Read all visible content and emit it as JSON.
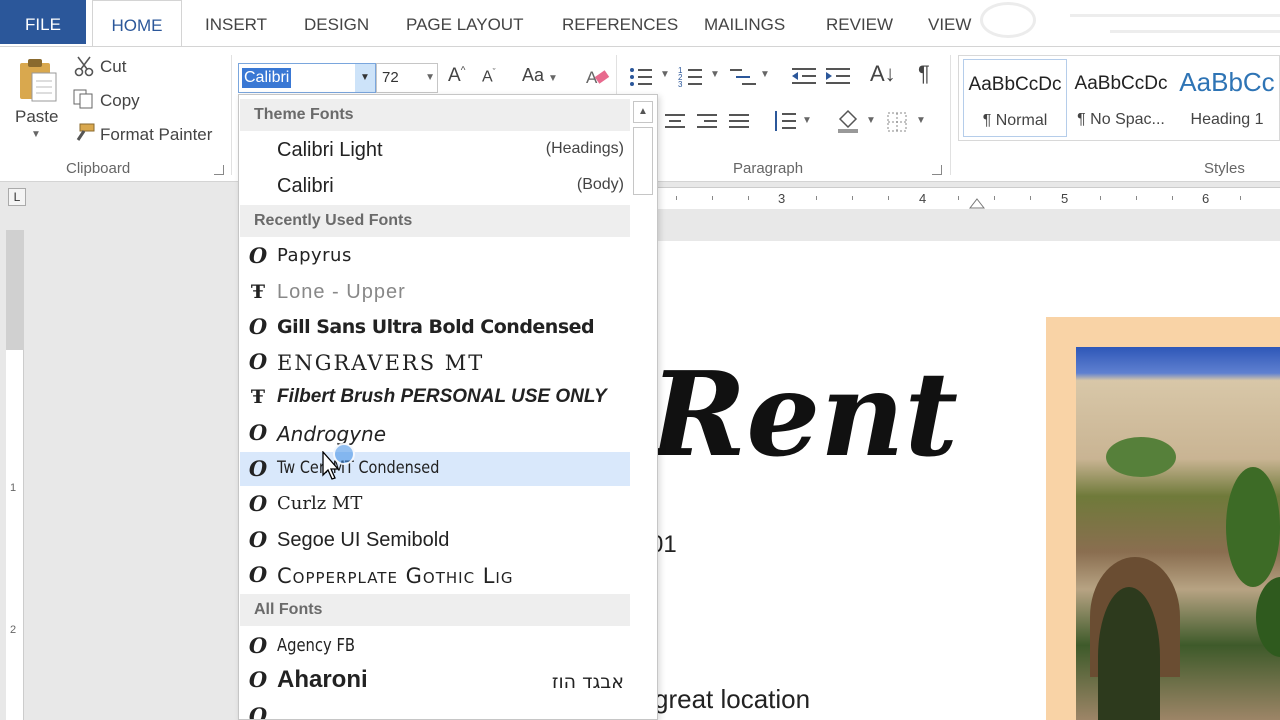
{
  "tabs": [
    "FILE",
    "HOME",
    "INSERT",
    "DESIGN",
    "PAGE LAYOUT",
    "REFERENCES",
    "MAILINGS",
    "REVIEW",
    "VIEW"
  ],
  "clipboard": {
    "paste": "Paste",
    "cut": "Cut",
    "copy": "Copy",
    "format_painter": "Format Painter",
    "group_label": "Clipboard"
  },
  "font": {
    "name": "Calibri",
    "size": "72",
    "change_case_label": "Aa"
  },
  "paragraph": {
    "group_label": "Paragraph"
  },
  "styles": {
    "group_label": "Styles",
    "items": [
      {
        "sample": "AaBbCcDc",
        "name": "¶ Normal"
      },
      {
        "sample": "AaBbCcDc",
        "name": "¶ No Spac..."
      },
      {
        "sample": "AaBbCc",
        "name": "Heading 1"
      }
    ]
  },
  "ruler": {
    "numbers": [
      "3",
      "4",
      "5",
      "6"
    ],
    "vertical_numbers": [
      "1",
      "2"
    ]
  },
  "font_dropdown": {
    "theme_header": "Theme Fonts",
    "theme_fonts": [
      {
        "name": "Calibri Light",
        "tag": "(Headings)"
      },
      {
        "name": "Calibri",
        "tag": "(Body)"
      }
    ],
    "recent_header": "Recently Used Fonts",
    "recent_fonts": [
      {
        "name": "Papyrus",
        "icon": "opentype-icon"
      },
      {
        "name": "Lone - Upper",
        "icon": "truetype-icon"
      },
      {
        "name": "Gill Sans Ultra Bold Condensed",
        "icon": "opentype-icon"
      },
      {
        "name": "ENGRAVERS MT",
        "icon": "opentype-icon"
      },
      {
        "name": "Filbert Brush PERSONAL USE ONLY",
        "icon": "truetype-icon"
      },
      {
        "name": "Androgyne",
        "icon": "opentype-icon"
      },
      {
        "name": "Tw Cen MT Condensed",
        "icon": "opentype-icon"
      },
      {
        "name": "Curlz MT",
        "icon": "opentype-icon"
      },
      {
        "name": "Segoe UI Semibold",
        "icon": "opentype-icon"
      },
      {
        "name": "Copperplate Gothic Lig",
        "icon": "opentype-icon"
      }
    ],
    "all_header": "All Fonts",
    "all_fonts": [
      {
        "name": "Agency FB",
        "icon": "opentype-icon"
      },
      {
        "name": "Aharoni",
        "icon": "opentype-icon",
        "sample": "אבגד הוז"
      }
    ],
    "selected_font": "Tw Cen MT Condensed"
  },
  "document": {
    "title": "Rent",
    "code_partial": "01",
    "line_partial": "great location"
  },
  "colors": {
    "file_tab": "#2b579a",
    "selection": "#d9e8fb",
    "photo_frame": "#f9d3a6"
  }
}
